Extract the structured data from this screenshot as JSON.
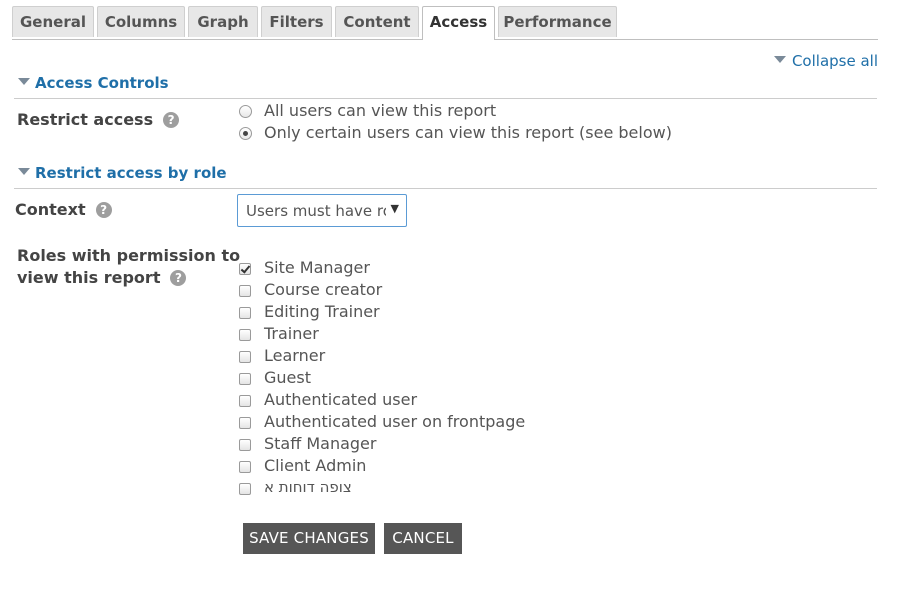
{
  "tabs": [
    {
      "label": "General",
      "active": false
    },
    {
      "label": "Columns",
      "active": false
    },
    {
      "label": "Graph",
      "active": false
    },
    {
      "label": "Filters",
      "active": false
    },
    {
      "label": "Content",
      "active": false
    },
    {
      "label": "Access",
      "active": true
    },
    {
      "label": "Performance",
      "active": false
    }
  ],
  "collapse_all": "Collapse all",
  "sections": {
    "access_controls": {
      "title": "Access Controls"
    },
    "restrict_by_role": {
      "title": "Restrict access by role"
    }
  },
  "restrict_access": {
    "label": "Restrict access",
    "help": "?",
    "options": [
      {
        "label": "All users can view this report",
        "checked": false
      },
      {
        "label": "Only certain users can view this report (see below)",
        "checked": true
      }
    ]
  },
  "context": {
    "label": "Context",
    "help": "?",
    "selected": "Users must have role"
  },
  "roles": {
    "label_line1": "Roles with permission to",
    "label_line2": "view this report",
    "help": "?",
    "items": [
      {
        "label": "Site Manager",
        "checked": true
      },
      {
        "label": "Course creator",
        "checked": false
      },
      {
        "label": "Editing Trainer",
        "checked": false
      },
      {
        "label": "Trainer",
        "checked": false
      },
      {
        "label": "Learner",
        "checked": false
      },
      {
        "label": "Guest",
        "checked": false
      },
      {
        "label": "Authenticated user",
        "checked": false
      },
      {
        "label": "Authenticated user on frontpage",
        "checked": false
      },
      {
        "label": "Staff Manager",
        "checked": false
      },
      {
        "label": "Client Admin",
        "checked": false
      },
      {
        "label": "צופה דוחות א",
        "checked": false
      }
    ]
  },
  "buttons": {
    "save": "SAVE CHANGES",
    "cancel": "CANCEL"
  }
}
